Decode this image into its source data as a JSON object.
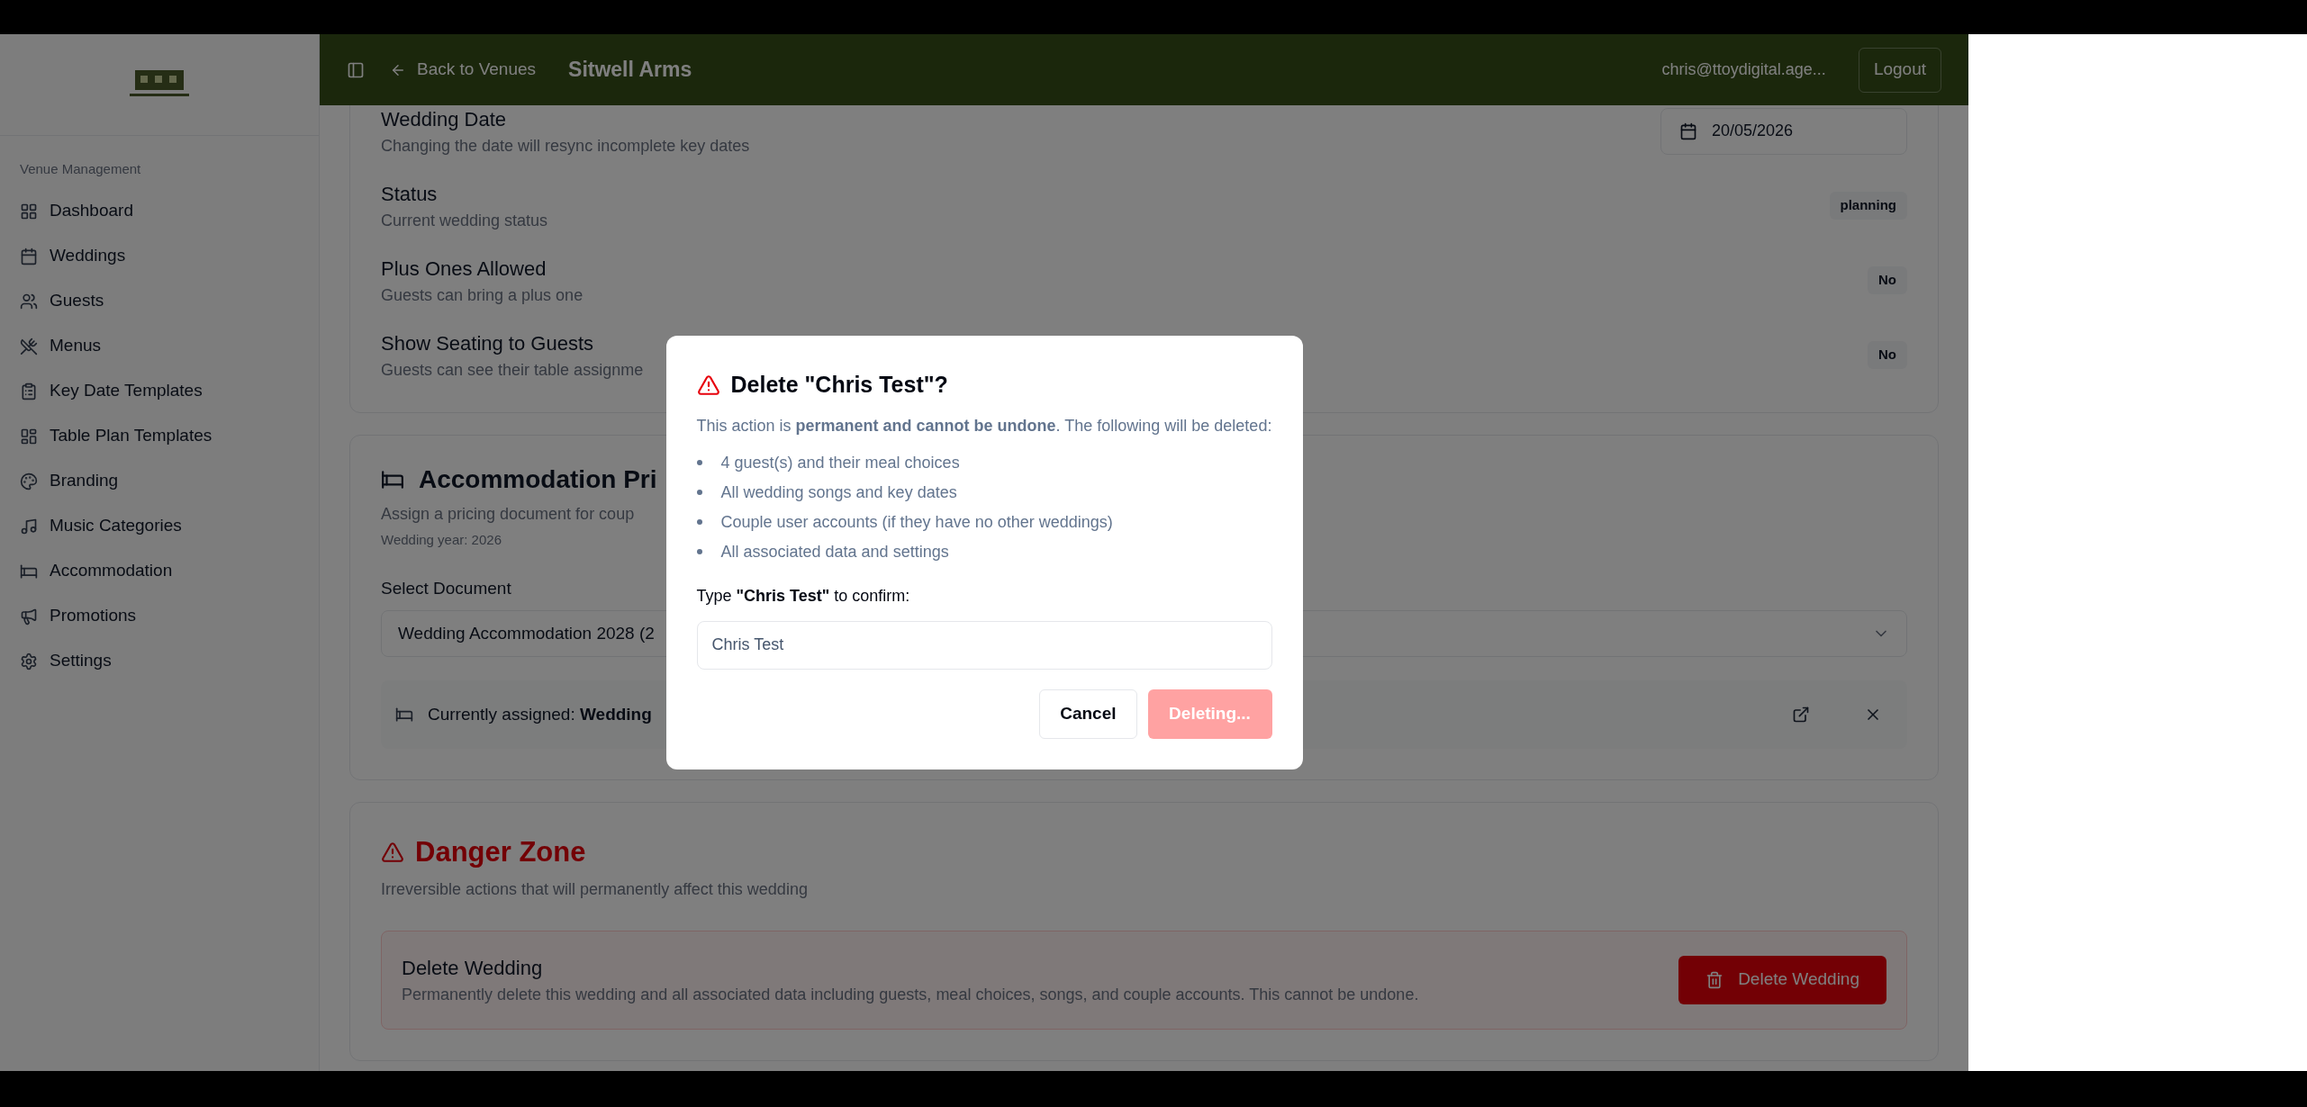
{
  "sidebar": {
    "section_label": "Venue Management",
    "items": [
      {
        "label": "Dashboard"
      },
      {
        "label": "Weddings"
      },
      {
        "label": "Guests"
      },
      {
        "label": "Menus"
      },
      {
        "label": "Key Date Templates"
      },
      {
        "label": "Table Plan Templates"
      },
      {
        "label": "Branding"
      },
      {
        "label": "Music Categories"
      },
      {
        "label": "Accommodation"
      },
      {
        "label": "Promotions"
      },
      {
        "label": "Settings"
      }
    ]
  },
  "header": {
    "back_link": "Back to Venues",
    "title": "Sitwell Arms",
    "user_email": "chris@ttoydigital.age...",
    "logout": "Logout"
  },
  "wedding_settings": [
    {
      "title": "Wedding Date",
      "description": "Changing the date will resync incomplete key dates",
      "kind": "date",
      "value": "20/05/2026"
    },
    {
      "title": "Status",
      "description": "Current wedding status",
      "kind": "badge",
      "value": "planning"
    },
    {
      "title": "Plus Ones Allowed",
      "description": "Guests can bring a plus one",
      "kind": "badge",
      "value": "No"
    },
    {
      "title": "Show Seating to Guests",
      "description": "Guests can see their table assignme",
      "kind": "badge",
      "value": "No"
    }
  ],
  "accommodation": {
    "title": "Accommodation Pri",
    "description": "Assign a pricing document for coup",
    "year_note": "Wedding year: 2026",
    "select_label": "Select Document",
    "select_value": "Wedding Accommodation 2028 (2",
    "assigned": "Currently assigned: **Wedding**"
  },
  "danger_zone": {
    "title": "Danger Zone",
    "description": "Irreversible actions that will permanently affect this wedding",
    "action": {
      "title": "Delete Wedding",
      "description": "Permanently delete this wedding and all associated data including guests, meal choices, songs, and couple accounts. This cannot be undone.",
      "button": "Delete Wedding"
    }
  },
  "dialog": {
    "title": "Delete \"Chris Test\"?",
    "message": "This action is **permanent and cannot be undone**. The following will be deleted:",
    "items": [
      "4 guest(s) and their meal choices",
      "All wedding songs and key dates",
      "Couple user accounts (if they have no other weddings)",
      "All associated data and settings"
    ],
    "confirm_label": "Type **\"Chris Test\"** to confirm:",
    "input_value": "Chris Test",
    "cancel": "Cancel",
    "confirm": "Deleting...",
    "confirm_disabled": true
  }
}
